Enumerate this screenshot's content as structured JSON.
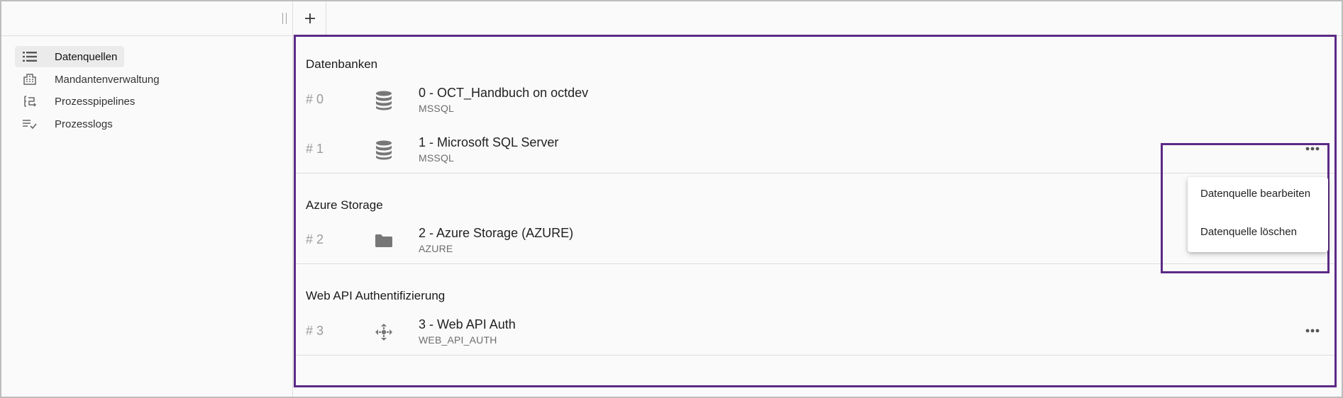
{
  "sidebar": {
    "items": [
      {
        "label": "Datenquellen",
        "icon": "list-icon",
        "active": true
      },
      {
        "label": "Mandantenverwaltung",
        "icon": "building-icon",
        "active": false
      },
      {
        "label": "Prozesspipelines",
        "icon": "pipeline-icon",
        "active": false
      },
      {
        "label": "Prozesslogs",
        "icon": "checklist-icon",
        "active": false
      }
    ]
  },
  "toolbar": {
    "add_icon": "plus-icon"
  },
  "sections": [
    {
      "title": "Datenbanken",
      "rows": [
        {
          "index": "# 0",
          "name": "0 - OCT_Handbuch on octdev",
          "type": "MSSQL",
          "icon": "database-icon"
        },
        {
          "index": "# 1",
          "name": "1 - Microsoft SQL Server",
          "type": "MSSQL",
          "icon": "database-icon"
        }
      ]
    },
    {
      "title": "Azure Storage",
      "rows": [
        {
          "index": "# 2",
          "name": "2 - Azure Storage (AZURE)",
          "type": "AZURE",
          "icon": "folder-icon"
        }
      ]
    },
    {
      "title": "Web API Authentifizierung",
      "rows": [
        {
          "index": "# 3",
          "name": "3 - Web API Auth",
          "type": "WEB_API_AUTH",
          "icon": "api-auth-icon"
        }
      ]
    }
  ],
  "context_menu": {
    "items": [
      "Datenquelle bearbeiten",
      "Datenquelle löschen"
    ]
  },
  "colors": {
    "highlight": "#5b2a86",
    "muted": "#9b9b9b"
  }
}
